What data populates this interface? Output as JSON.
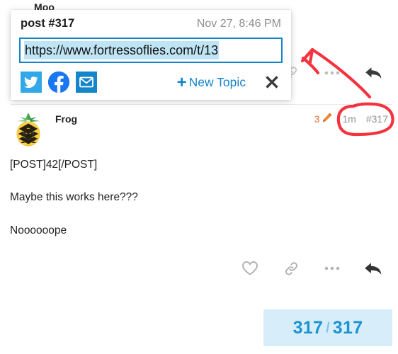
{
  "previous_post": {
    "username": "Moo",
    "actions": [
      {
        "name": "link-icon",
        "label": "Share link"
      },
      {
        "name": "more-icon",
        "label": "More"
      },
      {
        "name": "reply-icon",
        "label": "Reply"
      }
    ]
  },
  "post": {
    "username": "Frog",
    "avatar": "pineapple-emoji",
    "edit_count": "3",
    "edit_icon": "pencil-icon",
    "time": "1m",
    "post_number": "#317",
    "body": [
      "[POST]42[/POST]",
      "Maybe this works here???",
      "Noooooope"
    ],
    "actions": [
      {
        "name": "heart-icon",
        "label": "Like"
      },
      {
        "name": "link-icon",
        "label": "Share link"
      },
      {
        "name": "more-icon",
        "label": "More"
      },
      {
        "name": "reply-icon",
        "label": "Reply"
      }
    ]
  },
  "share_popup": {
    "title": "post #317",
    "date": "Nov 27, 8:46 PM",
    "url": "https://www.fortressoflies.com/t/13",
    "share_targets": [
      {
        "name": "twitter-icon",
        "label": "Twitter",
        "color": "#32a8e8"
      },
      {
        "name": "facebook-icon",
        "label": "Facebook",
        "color": "#1877f2"
      },
      {
        "name": "email-icon",
        "label": "Email",
        "color": "#1585c9"
      }
    ],
    "new_topic_label": "New Topic",
    "new_topic_plus": "+",
    "close_label": "Close"
  },
  "progress": {
    "current": "317",
    "separator": "/",
    "total": "317"
  },
  "colors": {
    "accent_blue": "#1585c9",
    "selection_blue": "#bfe5f5",
    "progress_bg": "#d7eefa",
    "progress_text": "#1b93d1",
    "edit_orange": "#e9713b",
    "meta_gray": "#919191",
    "annotation_red": "#f5333f"
  }
}
